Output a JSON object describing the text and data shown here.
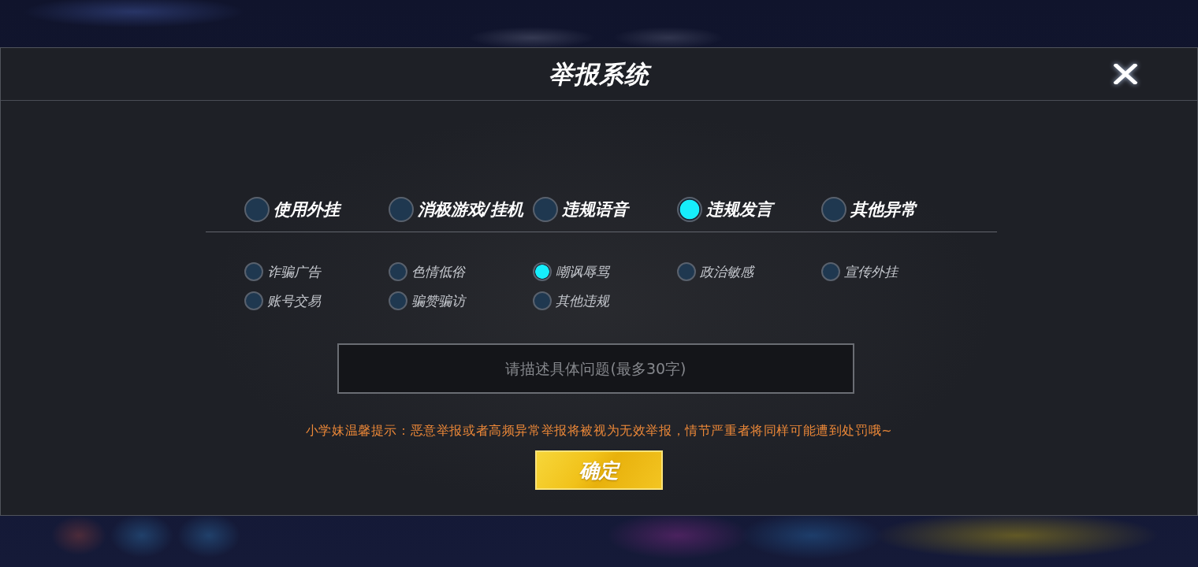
{
  "window": {
    "title": "举报系统"
  },
  "categories": [
    {
      "label": "使用外挂",
      "selected": false
    },
    {
      "label": "消极游戏/挂机",
      "selected": false
    },
    {
      "label": "违规语音",
      "selected": false
    },
    {
      "label": "违规发言",
      "selected": true
    },
    {
      "label": "其他异常",
      "selected": false
    }
  ],
  "subcategories": [
    {
      "label": "诈骗广告",
      "selected": false
    },
    {
      "label": "色情低俗",
      "selected": false
    },
    {
      "label": "嘲讽辱骂",
      "selected": true
    },
    {
      "label": "政治敏感",
      "selected": false
    },
    {
      "label": "宣传外挂",
      "selected": false
    },
    {
      "label": "账号交易",
      "selected": false
    },
    {
      "label": "骗赞骗访",
      "selected": false
    },
    {
      "label": "其他违规",
      "selected": false
    }
  ],
  "description": {
    "placeholder": "请描述具体问题(最多30字)"
  },
  "notice": "小学妹温馨提示：恶意举报或者高频异常举报将被视为无效举报，情节严重者将同样可能遭到处罚哦~",
  "confirm_button": "确定"
}
